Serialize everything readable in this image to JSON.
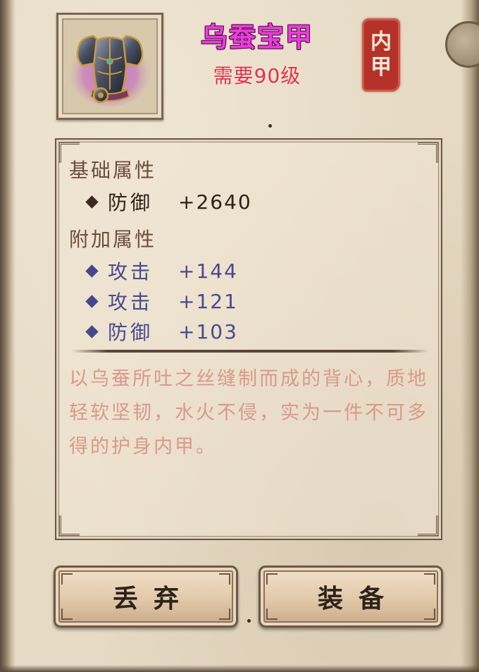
{
  "item": {
    "name": "乌蚕宝甲",
    "requirement": "需要90级",
    "type_seal": [
      "内",
      "甲"
    ],
    "icon": "armor-vest-icon",
    "name_color": "#e63fd6",
    "requirement_color": "#e0304a"
  },
  "base_attributes": {
    "title": "基础属性",
    "items": [
      {
        "name": "防御",
        "value": "+2640"
      }
    ]
  },
  "extra_attributes": {
    "title": "附加属性",
    "items": [
      {
        "name": "攻击",
        "value": "+144"
      },
      {
        "name": "攻击",
        "value": "+121"
      },
      {
        "name": "防御",
        "value": "+103"
      }
    ]
  },
  "description": "以乌蚕所吐之丝缝制而成的背心，质地轻软坚韧，水火不侵，实为一件不可多得的护身内甲。",
  "buttons": {
    "discard": "丢弃",
    "equip": "装备"
  }
}
